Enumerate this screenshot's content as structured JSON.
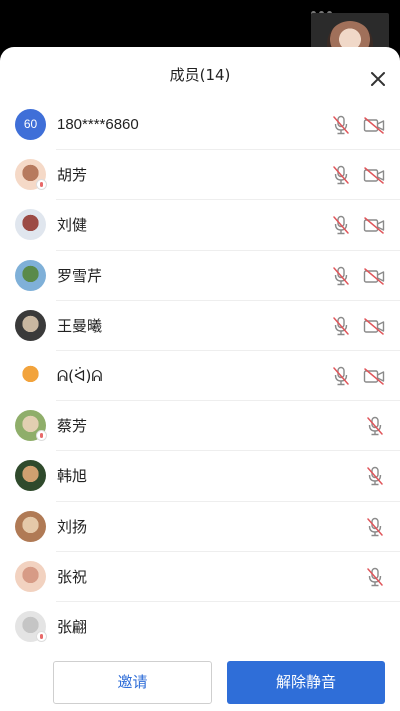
{
  "title": "成员(14)",
  "members": [
    {
      "name": "180****6860",
      "avatar_text": "60",
      "avatar_color": "#3f6fd8",
      "mic_muted": true,
      "camera": true
    },
    {
      "name": "胡芳",
      "avatar_colors": [
        "#f5d9c7",
        "#b77a5e"
      ],
      "mic_muted": true,
      "camera": true
    },
    {
      "name": "刘健",
      "avatar_colors": [
        "#e0e6ee",
        "#9c4b45"
      ],
      "mic_muted": true,
      "camera": true
    },
    {
      "name": "罗雪芹",
      "avatar_colors": [
        "#7fb0d8",
        "#5a8a4a"
      ],
      "mic_muted": true,
      "camera": true
    },
    {
      "name": "王曼曦",
      "avatar_colors": [
        "#3a3a3a",
        "#c9b7a1"
      ],
      "mic_muted": true,
      "camera": true
    },
    {
      "name": "ᕱ(ᐛ)ᕱ",
      "avatar_colors": [
        "#ffffff",
        "#f2a33c"
      ],
      "mic_muted": true,
      "camera": true
    },
    {
      "name": "蔡芳",
      "avatar_colors": [
        "#8fae6a",
        "#e2cfb1"
      ],
      "mic_muted": true,
      "camera": false
    },
    {
      "name": "韩旭",
      "avatar_colors": [
        "#2f4a2c",
        "#d0a070"
      ],
      "mic_muted": true,
      "camera": false
    },
    {
      "name": "刘扬",
      "avatar_colors": [
        "#b07a55",
        "#e5c9a9"
      ],
      "mic_muted": true,
      "camera": false
    },
    {
      "name": "张祝",
      "avatar_colors": [
        "#f2d2c0",
        "#d79b86"
      ],
      "mic_muted": true,
      "camera": false
    },
    {
      "name": "张翩",
      "avatar_colors": [
        "#e4e4e4",
        "#c5c5c5"
      ],
      "mic_muted": false,
      "camera": false
    }
  ],
  "footer": {
    "invite_label": "邀请",
    "unmute_label": "解除静音"
  },
  "colors": {
    "accent": "#2f6ed8",
    "muted_icon": "#e0555a",
    "icon_gray": "#8a8a8a"
  }
}
